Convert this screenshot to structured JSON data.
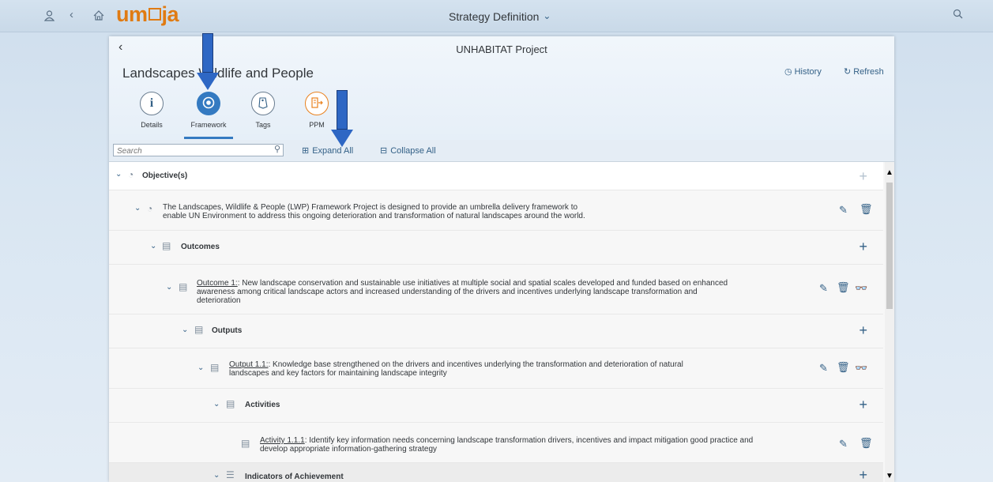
{
  "shell": {
    "title": "Strategy Definition",
    "logo_part1": "um",
    "logo_part2": "ja"
  },
  "header": {
    "project": "UNHABITAT Project",
    "title": "Landscapes Wildlife and People",
    "history_label": "History",
    "refresh_label": "Refresh"
  },
  "tabs": [
    {
      "label": "Details"
    },
    {
      "label": "Framework"
    },
    {
      "label": "Tags"
    },
    {
      "label": "PPM"
    }
  ],
  "toolbar": {
    "search_placeholder": "Search",
    "expand_all": "Expand All",
    "collapse_all": "Collapse All"
  },
  "tree": {
    "objectives_label": "Objective(s)",
    "objective_text_1": "The Landscapes, Wildlife & People (LWP) Framework Project is designed to provide an umbrella delivery framework to",
    "objective_text_2": "enable UN Environment to address this ongoing deterioration and transformation of natural landscapes around the world.",
    "outcomes_label": "Outcomes",
    "outcome_link": "Outcome 1:",
    "outcome_text_1": ": New landscape conservation and sustainable use initiatives at multiple social and spatial scales developed and funded based on enhanced",
    "outcome_text_2": "awareness among critical landscape actors and increased understanding of the drivers and incentives underlying landscape transformation and",
    "outcome_text_3": "deterioration",
    "outputs_label": "Outputs",
    "output_link": "Output 1.1:",
    "output_text_1": ": Knowledge base strengthened on the drivers and incentives underlying the transformation and deterioration of natural",
    "output_text_2": "landscapes and key factors for maintaining landscape integrity",
    "activities_label": "Activities",
    "activity_link": "Activity 1.1.1",
    "activity_text_1": ": Identify key information needs concerning landscape transformation drivers, incentives and impact mitigation good practice and",
    "activity_text_2": "develop appropriate information-gathering strategy",
    "indicators_label": "Indicators of Achievement"
  },
  "colors": {
    "accent": "#347ac1",
    "logo": "#e07b13",
    "link": "#346187",
    "arrow": "#2e67c4"
  }
}
